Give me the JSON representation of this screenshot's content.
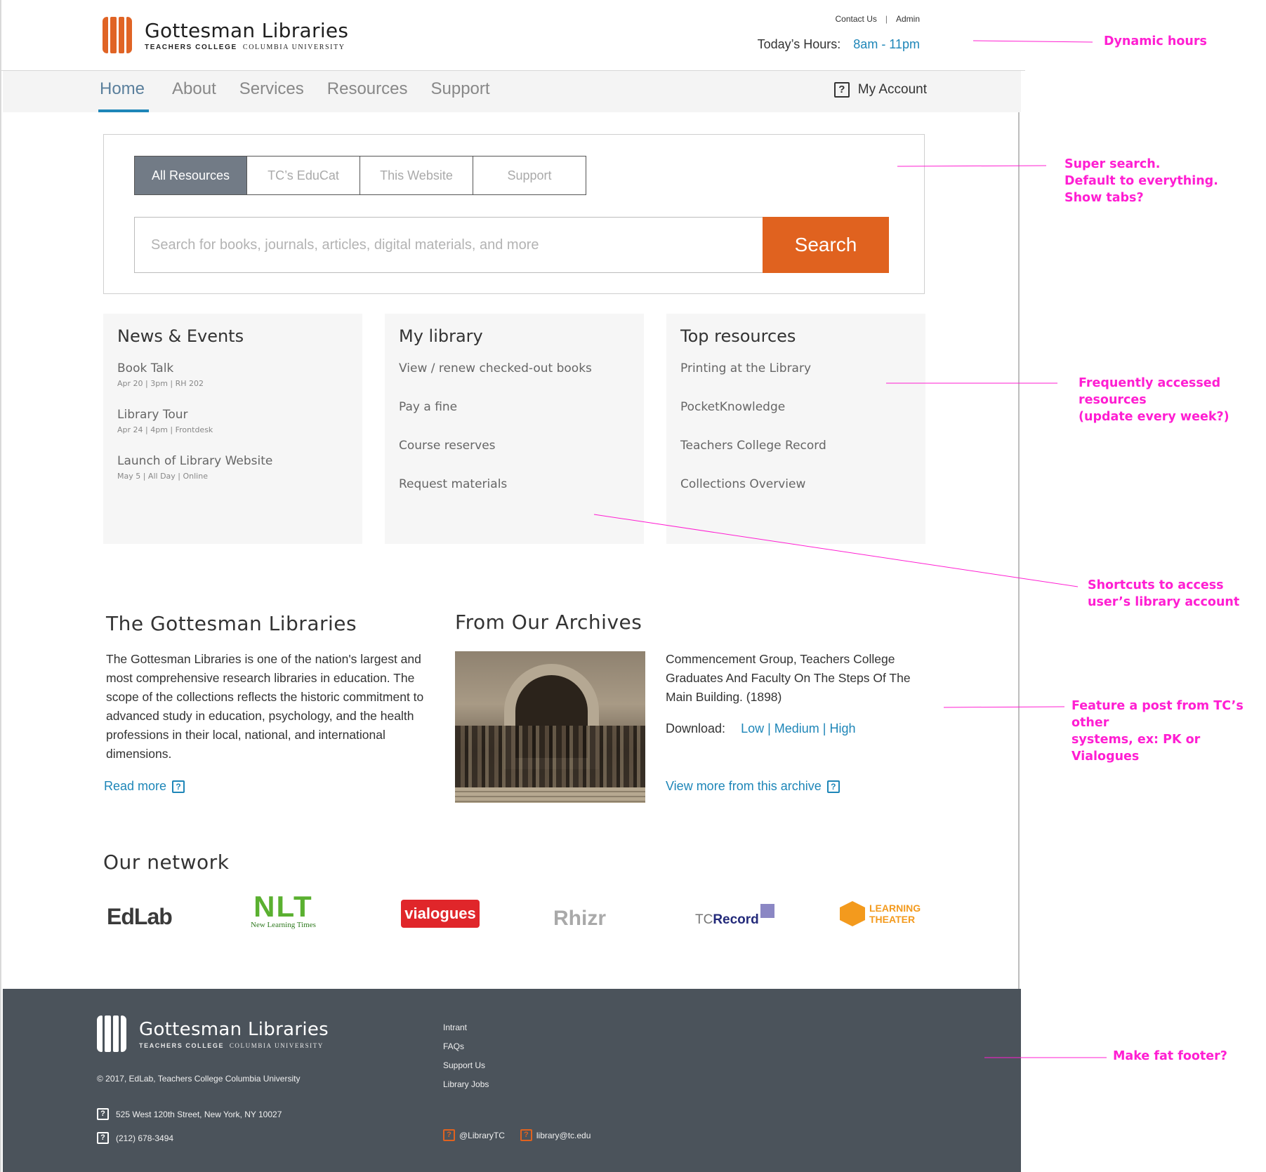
{
  "header": {
    "logo_title": "Gottesman Libraries",
    "logo_sub_bold": "TEACHERS COLLEGE",
    "logo_sub_rest": "COLUMBIA UNIVERSITY",
    "contact_label": "Contact Us",
    "separator": "|",
    "admin_label": "Admin",
    "hours_label": "Today’s Hours:",
    "hours_value": "8am - 11pm"
  },
  "nav": {
    "items": [
      {
        "label": "Home",
        "active": true
      },
      {
        "label": "About"
      },
      {
        "label": "Services"
      },
      {
        "label": "Resources"
      },
      {
        "label": "Support"
      }
    ],
    "account_label": "My Account"
  },
  "search": {
    "tabs": [
      "All Resources",
      "TC’s EduCat",
      "This Website",
      "Support"
    ],
    "placeholder": "Search for books, journals, articles, digital materials, and more",
    "button_label": "Search"
  },
  "news": {
    "title": "News & Events",
    "events": [
      {
        "title": "Book Talk",
        "detail": "Apr 20 | 3pm | RH 202"
      },
      {
        "title": "Library Tour",
        "detail": "Apr 24 | 4pm | Frontdesk"
      },
      {
        "title": "Launch of Library Website",
        "detail": "May 5 | All Day | Online"
      }
    ]
  },
  "my_library": {
    "title": "My library",
    "items": [
      "View / renew checked-out books",
      "Pay a fine",
      "Course reserves",
      "Request materials"
    ]
  },
  "top_resources": {
    "title": "Top resources",
    "items": [
      "Printing at the Library",
      "PocketKnowledge",
      "Teachers College Record",
      "Collections Overview"
    ]
  },
  "about": {
    "title": "The Gottesman Libraries",
    "body": "The Gottesman Libraries is one of the nation's largest and most comprehensive research libraries in education. The scope of the collections reflects the historic commitment to advanced study in education, psychology, and the health professions in their local, national, and international dimensions.",
    "read_more": "Read more"
  },
  "archives": {
    "title": "From Our Archives",
    "caption": "Commencement Group, Teachers College Graduates And Faculty On The Steps Of The Main Building. (1898)",
    "download_label": "Download:",
    "download_options": "Low | Medium | High",
    "view_more": "View more from this archive"
  },
  "network": {
    "title": "Our network",
    "logos": [
      {
        "name": "EdLab",
        "color": "#3a3a3a"
      },
      {
        "name": "NLT",
        "sub": "New Learning Times",
        "color": "#5ab030"
      },
      {
        "name": "vialogues",
        "color": "#e0262a"
      },
      {
        "name": "Rhizr",
        "color": "#a9a9a9"
      },
      {
        "name_pre": "TC",
        "name_post": "Record",
        "color": "#232a7a"
      },
      {
        "name_top": "LEARNING",
        "name_bottom": "THEATER",
        "color": "#f39a1d"
      }
    ]
  },
  "footer": {
    "logo_title": "Gottesman Libraries",
    "logo_sub_bold": "TEACHERS COLLEGE",
    "logo_sub_rest": "COLUMBIA UNIVERSITY",
    "copyright": "© 2017, EdLab, Teachers College Columbia University",
    "address": "525 West 120th Street, New York, NY 10027",
    "phone": "(212) 678-3494",
    "links": [
      "Intrant",
      "FAQs",
      "Support Us",
      "Library Jobs"
    ],
    "twitter": "@LibraryTC",
    "email": "library@tc.edu"
  },
  "annotations": {
    "hours": "Dynamic hours",
    "search_1": "Super search.",
    "search_2": "Default to everything.",
    "search_3": "Show tabs?",
    "resources_1": "Frequently accessed resources",
    "resources_2": "(update every week?)",
    "shortcuts_1": "Shortcuts to access",
    "shortcuts_2": "user’s library account",
    "feature_1": "Feature a post from TC’s other",
    "feature_2": "systems, ex: PK or Vialogues",
    "footer": "Make fat footer?"
  },
  "colors": {
    "accent": "#e0621f",
    "link": "#1e86b8",
    "annotation": "#ff1ed2",
    "footer_bg": "#4b535b"
  }
}
